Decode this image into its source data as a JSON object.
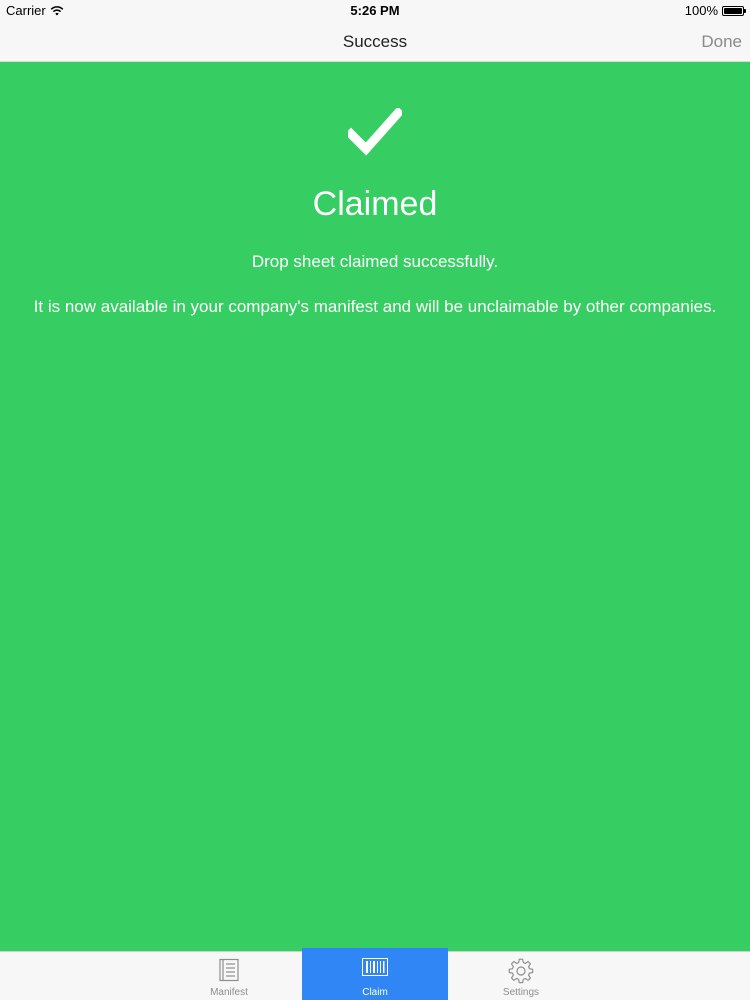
{
  "status_bar": {
    "carrier": "Carrier",
    "time": "5:26 PM",
    "battery": "100%"
  },
  "nav": {
    "title": "Success",
    "done_label": "Done"
  },
  "content": {
    "background_color": "#36cd62",
    "icon": "checkmark-icon",
    "heading": "Claimed",
    "message": "Drop sheet claimed successfully.",
    "detail": "It is now available in your company's manifest and will be unclaimable by other companies."
  },
  "tab_bar": {
    "tabs": [
      {
        "label": "Manifest",
        "icon": "manifest-icon",
        "selected": false
      },
      {
        "label": "Claim",
        "icon": "barcode-icon",
        "selected": true
      },
      {
        "label": "Settings",
        "icon": "gear-icon",
        "selected": false
      }
    ],
    "selected_color": "#2f86f4"
  }
}
